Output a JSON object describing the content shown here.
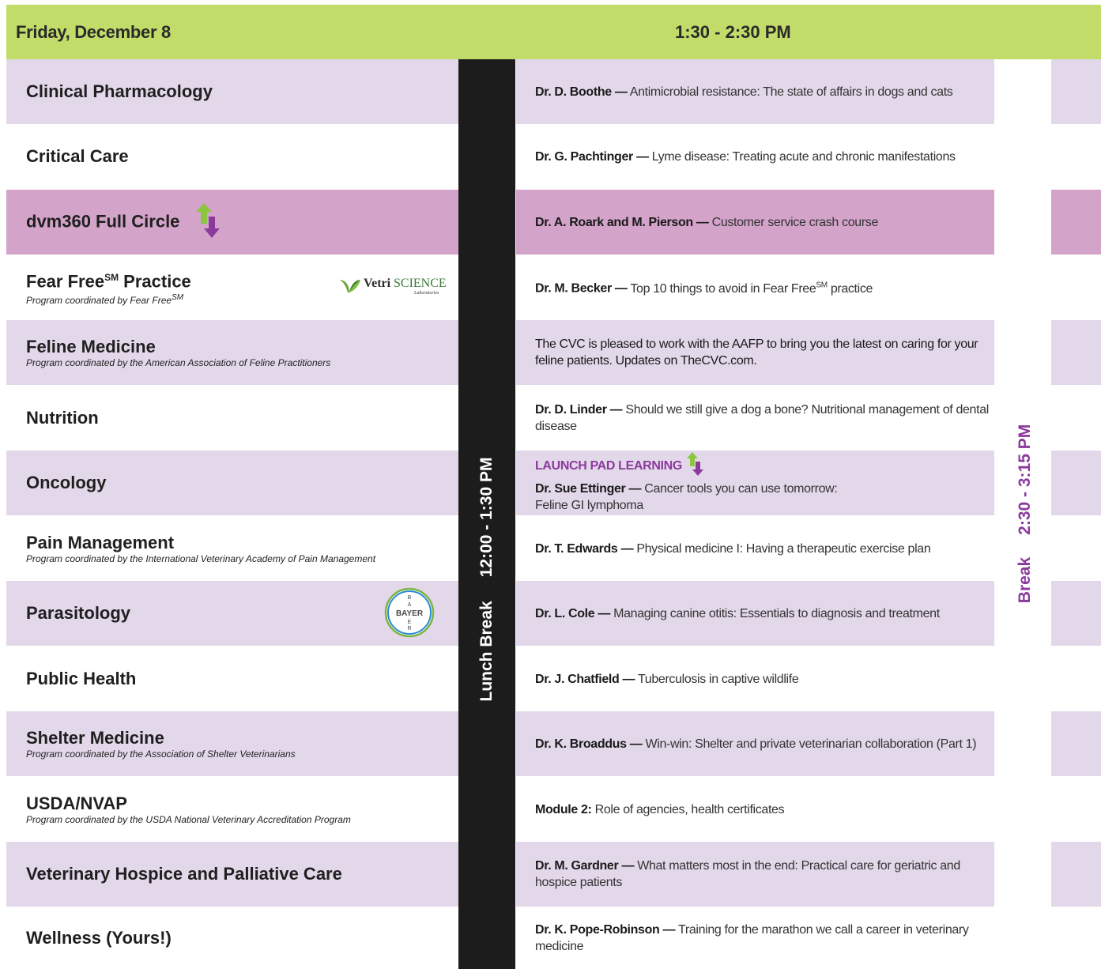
{
  "header": {
    "day": "Friday, December 8",
    "time_slot": "1:30 - 2:30 PM"
  },
  "lunch_break": {
    "label": "Lunch Break",
    "time": "12:00 - 1:30 PM"
  },
  "break": {
    "label": "Break",
    "time": "2:30 - 3:15 PM"
  },
  "logos": {
    "vetri_brand": "Vetri",
    "vetri_science": "SCIENCE",
    "vetri_sub": "Laboratories",
    "bayer_text": "BAYER"
  },
  "colors": {
    "header_green": "#c2dc6a",
    "row_lavender": "#e3d8ea",
    "row_accent": "#d3a3c9",
    "lunch_black": "#1c1c1c",
    "purple": "#8b3a9c",
    "arrow_green": "#8cc63f"
  },
  "rows": [
    {
      "track": "Clinical Pharmacology",
      "speaker": "Dr. D. Boothe —",
      "session": " Antimicrobial resistance: The state of affairs in dogs and cats"
    },
    {
      "track": "Critical Care",
      "speaker": "Dr. G. Pachtinger —",
      "session": " Lyme disease: Treating acute and chronic manifestations"
    },
    {
      "track": "dvm360 Full Circle",
      "speaker": "Dr. A. Roark and M. Pierson —",
      "session": " Customer service crash course"
    },
    {
      "track": "Fear Free",
      "track_sup": "SM",
      "track_tail": " Practice",
      "coordinator": "Program coordinated by Fear Free",
      "coordinator_sup": "SM",
      "speaker": "Dr. M. Becker —",
      "session": " Top 10 things to avoid in Fear Free",
      "session_sup": "SM",
      "session_tail": " practice"
    },
    {
      "track": "Feline Medicine",
      "coordinator": "Program coordinated by the American Association of Feline Practitioners",
      "session": "The CVC is pleased to work with the AAFP to bring you the latest on caring for your feline patients. Updates on TheCVC.com."
    },
    {
      "track": "Nutrition",
      "speaker": "Dr. D. Linder —",
      "session": " Should we still give a dog a bone? Nutritional management of dental disease"
    },
    {
      "track": "Oncology",
      "tag": "LAUNCH PAD LEARNING",
      "speaker": "Dr. Sue Ettinger —",
      "session": "  Cancer tools you can use tomorrow:",
      "session_line2": "Feline GI lymphoma"
    },
    {
      "track": "Pain Management",
      "coordinator": "Program coordinated  by the International Veterinary Academy of Pain Management",
      "speaker": "Dr. T. Edwards —",
      "session": " Physical medicine I: Having a therapeutic exercise plan"
    },
    {
      "track": "Parasitology",
      "speaker": "Dr. L. Cole —",
      "session": " Managing canine otitis: Essentials to diagnosis and treatment"
    },
    {
      "track": "Public Health",
      "speaker": "Dr. J. Chatfield —",
      "session": " Tuberculosis in captive wildlife"
    },
    {
      "track": "Shelter Medicine",
      "coordinator": "Program coordinated by the Association of Shelter Veterinarians",
      "speaker": "Dr. K. Broaddus —",
      "session": " Win-win: Shelter and private veterinarian collaboration (Part 1)"
    },
    {
      "track": "USDA/NVAP",
      "coordinator": "Program coordinated by the USDA National Veterinary Accreditation Program",
      "speaker": "Module 2:",
      "session": " Role of agencies, health certificates"
    },
    {
      "track": "Veterinary Hospice and Palliative Care",
      "speaker": "Dr. M. Gardner —",
      "session": " What matters most in the end: Practical care for geriatric and hospice patients"
    },
    {
      "track": "Wellness (Yours!)",
      "speaker": "Dr. K. Pope-Robinson —",
      "session": " Training for the marathon we call a career in veterinary medicine"
    }
  ]
}
